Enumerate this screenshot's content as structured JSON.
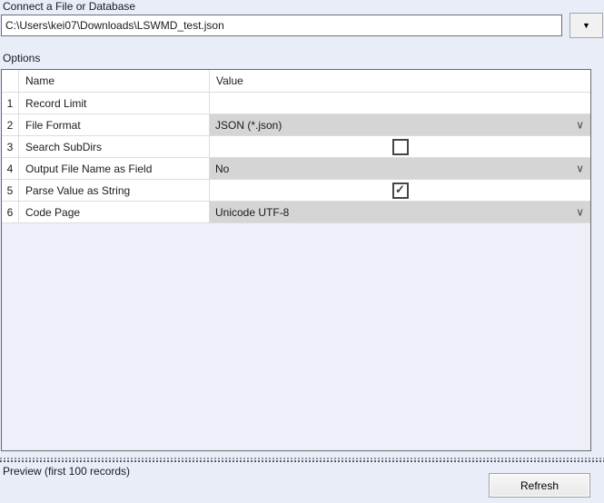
{
  "file_section": {
    "label": "Connect a File or Database",
    "path_value": "C:\\Users\\kei07\\Downloads\\LSWMD_test.json"
  },
  "options_section": {
    "label": "Options",
    "table": {
      "columns": {
        "name": "Name",
        "value": "Value"
      },
      "rows": [
        {
          "num": "1",
          "name": "Record Limit",
          "type": "text",
          "value": ""
        },
        {
          "num": "2",
          "name": "File Format",
          "type": "dropdown",
          "value": "JSON (*.json)"
        },
        {
          "num": "3",
          "name": "Search SubDirs",
          "type": "checkbox",
          "checked": false
        },
        {
          "num": "4",
          "name": "Output File Name as Field",
          "type": "dropdown",
          "value": "No"
        },
        {
          "num": "5",
          "name": "Parse Value as String",
          "type": "checkbox",
          "checked": true
        },
        {
          "num": "6",
          "name": "Code Page",
          "type": "dropdown",
          "value": "Unicode UTF-8"
        }
      ]
    }
  },
  "preview_bar": {
    "label": "Preview (first 100 records)",
    "refresh_label": "Refresh"
  },
  "icons": {
    "dropdown_arrow": "▼",
    "chevron_down": "∨",
    "check": "✓"
  },
  "colors": {
    "background": "#E9EDF8",
    "table_background": "#EDF0F9",
    "combo_fill": "#D5D5D5",
    "border_dark": "#6A6A6A",
    "gridline": "#DADDE2"
  }
}
